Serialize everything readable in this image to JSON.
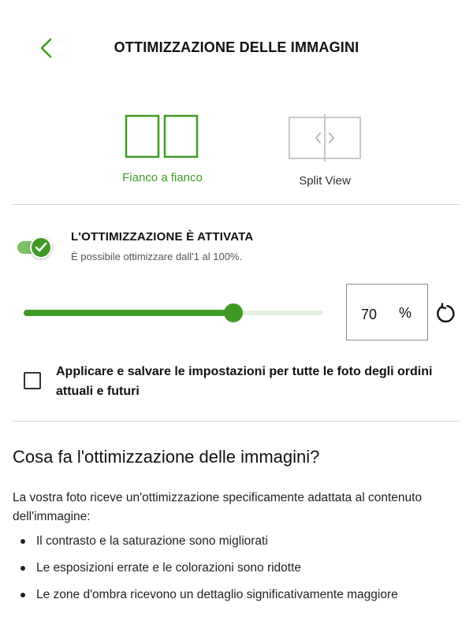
{
  "header": {
    "title": "OTTIMIZZAZIONE DELLE IMMAGINI",
    "back_icon": "chevron-left-icon"
  },
  "colors": {
    "accent": "#3f9a25",
    "accent_light": "#7cc166",
    "track_light": "#e2efdd",
    "divider": "#d6d6d6"
  },
  "view_modes": {
    "side_by_side_label": "Fianco a fianco",
    "split_view_label": "Split View",
    "selected": "Fianco a fianco"
  },
  "optimization": {
    "title": "L'OTTIMIZZAZIONE È ATTIVATA",
    "subtitle": "È possibile ottimizzare dall'1 al 100%.",
    "enabled": true,
    "slider_value_fraction": 0.7,
    "value": "70",
    "unit": "%"
  },
  "apply_all": {
    "checked": false,
    "label": "Applicare e salvare le impostazioni per tutte le foto degli ordini attuali e futuri"
  },
  "info": {
    "title": "Cosa fa l'ottimizzazione delle immagini?",
    "body": "La vostra foto riceve un'ottimizzazione specificamente adattata al contenuto dell'immagine:",
    "bullets": [
      "Il contrasto e la saturazione sono migliorati",
      "Le esposizioni errate e le colorazioni sono ridotte",
      "Le zone d'ombra ricevono un dettaglio significativamente maggiore"
    ]
  }
}
